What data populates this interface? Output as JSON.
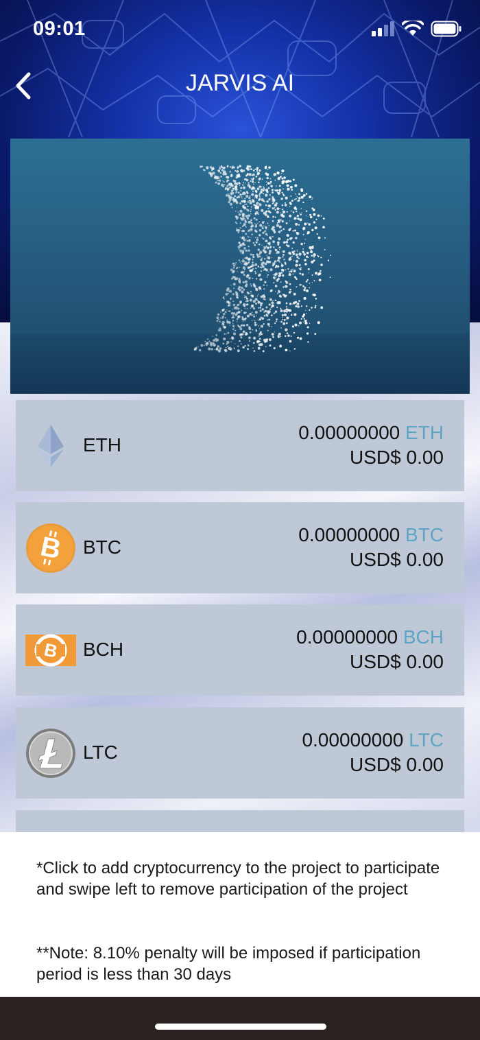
{
  "status_bar": {
    "time": "09:01"
  },
  "nav": {
    "title": "JARVIS AI"
  },
  "coins": [
    {
      "symbol": "ETH",
      "amount": "0.00000000",
      "unit": "ETH",
      "usd": "USD$ 0.00"
    },
    {
      "symbol": "BTC",
      "amount": "0.00000000",
      "unit": "BTC",
      "usd": "USD$ 0.00"
    },
    {
      "symbol": "BCH",
      "amount": "0.00000000",
      "unit": "BCH",
      "usd": "USD$ 0.00"
    },
    {
      "symbol": "LTC",
      "amount": "0.00000000",
      "unit": "LTC",
      "usd": "USD$ 0.00"
    }
  ],
  "notes": {
    "instruction": "*Click to add cryptocurrency to the project to participate and swipe left to remove participation of the project",
    "penalty": "**Note: 8.10% penalty will be imposed if participation period is less than 30 days"
  },
  "colors": {
    "unit_accent": "#5ea5c3",
    "card_bg": "#bec8d6",
    "btc_orange": "#f2a13b"
  },
  "icons": [
    "back-chevron-icon",
    "cellular-signal-icon",
    "wifi-icon",
    "battery-icon",
    "eth-icon",
    "btc-icon",
    "bch-icon",
    "ltc-icon"
  ]
}
